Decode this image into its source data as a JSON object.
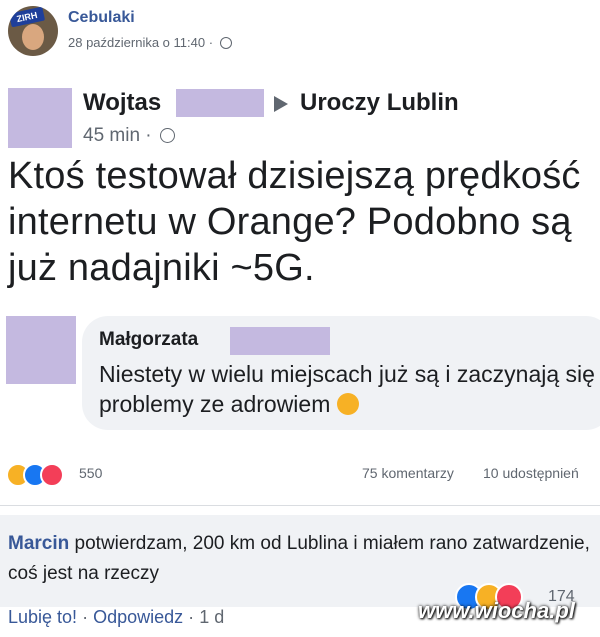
{
  "header": {
    "author": "Cebulaki",
    "avatar_badge": "ZIRH",
    "date": "28 października o 11:40 ·"
  },
  "post": {
    "poster_name": "Wojtas",
    "group": "Uroczy Lublin",
    "time": "45 min ·",
    "text": "Ktoś testował dzisiejszą prędkość internetu w Orange? Podobno są już nadajniki ~5G."
  },
  "comment": {
    "name": "Małgorzata",
    "text": "Niestety w wielu miejscach już są i zaczynają się problemy ze adrowiem"
  },
  "stats": {
    "reactions_count": "550",
    "comments": "75 komentarzy",
    "shares": "10 udostępnień"
  },
  "reply": {
    "name": "Marcin",
    "text": "potwierdzam, 200 km od Lublina i miałem rano zatwardzenie, coś jest na rzeczy",
    "like_label": "Lubię to!",
    "reply_label": "Odpowiedz",
    "age": "1 d",
    "reactions_count": "174"
  },
  "watermark": "www.wiocha.pl",
  "colors": {
    "link": "#385898",
    "blur": "#c4b9e0",
    "bubble": "#f0f2f5"
  }
}
